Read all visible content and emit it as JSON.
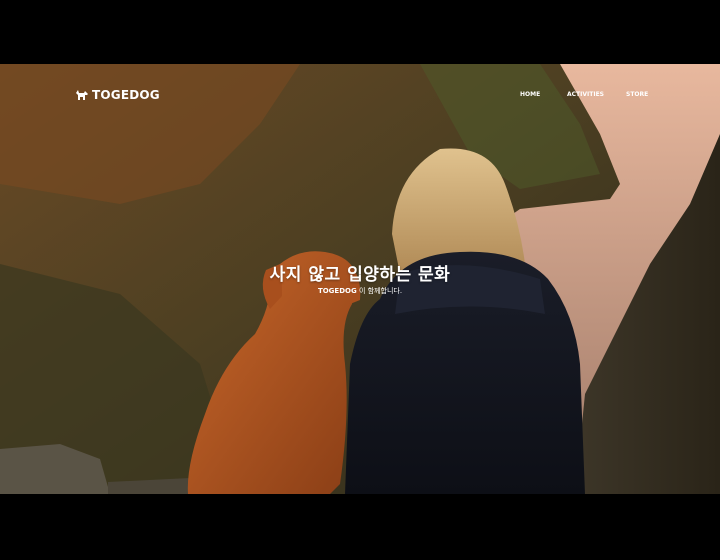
{
  "header": {
    "logo_text": "TOGEDOG",
    "nav": [
      {
        "label": "HOME"
      },
      {
        "label": "ACTIVITIES"
      },
      {
        "label": "STORE"
      }
    ]
  },
  "hero": {
    "title": "사지 않고 입양하는 문화",
    "subtitle_brand": "TOGEDOG",
    "subtitle_rest": "이 함께합니다."
  },
  "colors": {
    "text": "#ffffff",
    "letterbox": "#000000"
  }
}
